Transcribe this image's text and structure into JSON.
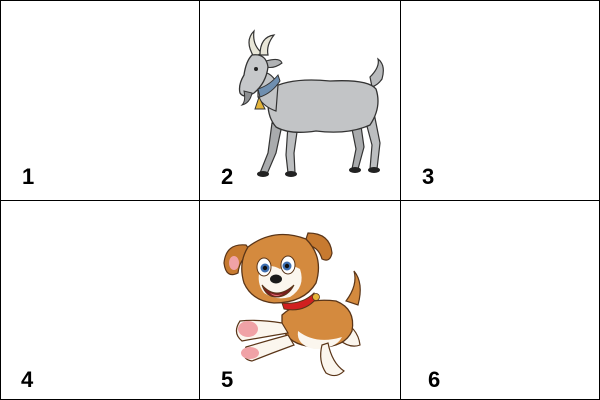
{
  "cells": [
    {
      "number": "1",
      "image": null
    },
    {
      "number": "2",
      "image": "goat"
    },
    {
      "number": "3",
      "image": null
    },
    {
      "number": "4",
      "image": null
    },
    {
      "number": "5",
      "image": "puppy"
    },
    {
      "number": "6",
      "image": null
    }
  ]
}
